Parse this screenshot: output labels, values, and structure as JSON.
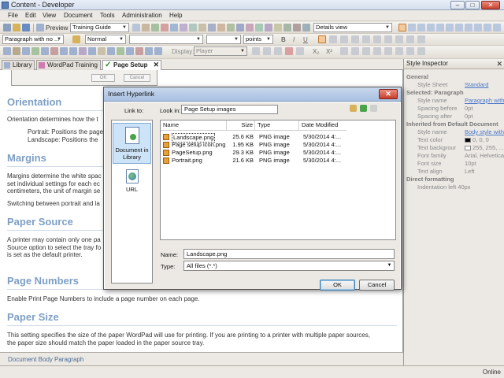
{
  "window": {
    "title": "Content - Developer"
  },
  "menu": [
    "File",
    "Edit",
    "View",
    "Document",
    "Tools",
    "Administration",
    "Help"
  ],
  "toolbar1": {
    "preview_label": "Preview",
    "guide_value": "Training Guide",
    "view_value": "Details view"
  },
  "toolbar2": {
    "paragraph_value": "Paragraph with no ...",
    "style_value": "Normal",
    "font_value": "",
    "size_value": "",
    "unit_value": "points",
    "bold": "B",
    "italic": "I",
    "underline": "U"
  },
  "toolbar3": {
    "display_label": "Display:",
    "display_value": "Player",
    "sub": "X₂",
    "sup": "X²"
  },
  "tabs": [
    {
      "label": "Library"
    },
    {
      "label": "WordPad Training"
    },
    {
      "label": "Page Setup",
      "active": true
    }
  ],
  "tab_close": "✕",
  "mini_buttons": {
    "ok": "OK",
    "cancel": "Cancel"
  },
  "document": {
    "h_orientation": "Orientation",
    "p_orientation": "Orientation determines how the t",
    "p_portrait": "Portrait: Positions the page",
    "p_landscape": "Landscape: Positions the",
    "h_margins": "Margins",
    "p_margins1": "Margins determine the white spac",
    "p_margins2": "set individual settings for each ec",
    "p_margins3": "centimeters, the unit of margin se",
    "p_margins4": "Switching between portrait and la",
    "h_source": "Paper Source",
    "p_source1": "A printer may contain only one pa",
    "p_source2": "Source option to select the tray fo",
    "p_source3": "is set as the default printer.",
    "h_numbers": "Page Numbers",
    "p_numbers": "Enable Print Page Numbers to include a page number on each page.",
    "h_size": "Paper Size",
    "p_size1": "This setting specifies the size of the paper WordPad will use for printing. If you are printing to a printer with multiple paper sources,",
    "p_size2": "the paper size should match the paper loaded in the paper source tray."
  },
  "doc_status": {
    "body": "Document Body",
    "para": "Paragraph"
  },
  "bottom": {
    "online": "Online"
  },
  "inspector": {
    "title": "Style Inspector",
    "general": "General",
    "style_sheet_label": "Style Sheet",
    "style_sheet_value": "Standard",
    "selected": "Selected: Paragraph",
    "style_name_label": "Style name",
    "style_name_value": "Paragraph with n...",
    "spacing_before_label": "Spacing before",
    "spacing_before_value": "0pt",
    "spacing_after_label": "Spacing after",
    "spacing_after_value": "0pt",
    "inherited": "Inherited from Default Document",
    "style_name2_label": "Style name",
    "style_name2_value": "Body style with 8...",
    "text_color_label": "Text color",
    "text_color_value": "0, 0, 0",
    "text_bg_label": "Text backgrour",
    "text_bg_value": "255, 255, ...",
    "font_family_label": "Font family",
    "font_family_value": "Arial, Helvetica, ...",
    "font_size_label": "Font size",
    "font_size_value": "10pt",
    "text_align_label": "Text align",
    "text_align_value": "Left",
    "direct": "Direct formatting",
    "indent_label": "Indentation left 40px"
  },
  "dialog": {
    "title": "Insert Hyperlink",
    "close": "✕",
    "link_to_label": "Link to:",
    "look_in_label": "Look in:",
    "look_in_value": "Page Setup images",
    "link_items": [
      "Document in Library",
      "URL"
    ],
    "columns": [
      "Name",
      "Size",
      "Type",
      "Date Modified"
    ],
    "files": [
      {
        "name": "Landscape.png",
        "size": "25.6 KB",
        "type": "PNG image",
        "date": "5/30/2014 4:..."
      },
      {
        "name": "Page setup icon.png",
        "size": "1.95 KB",
        "type": "PNG image",
        "date": "5/30/2014 4:..."
      },
      {
        "name": "PageSetup.png",
        "size": "29.3 KB",
        "type": "PNG image",
        "date": "5/30/2014 4:..."
      },
      {
        "name": "Portrait.png",
        "size": "21.6 KB",
        "type": "PNG image",
        "date": "5/30/2014 4:..."
      }
    ],
    "name_label": "Name:",
    "name_value": "Landscape.png",
    "type_label": "Type:",
    "type_value": "All files (*.*)",
    "ok": "OK",
    "cancel": "Cancel"
  }
}
